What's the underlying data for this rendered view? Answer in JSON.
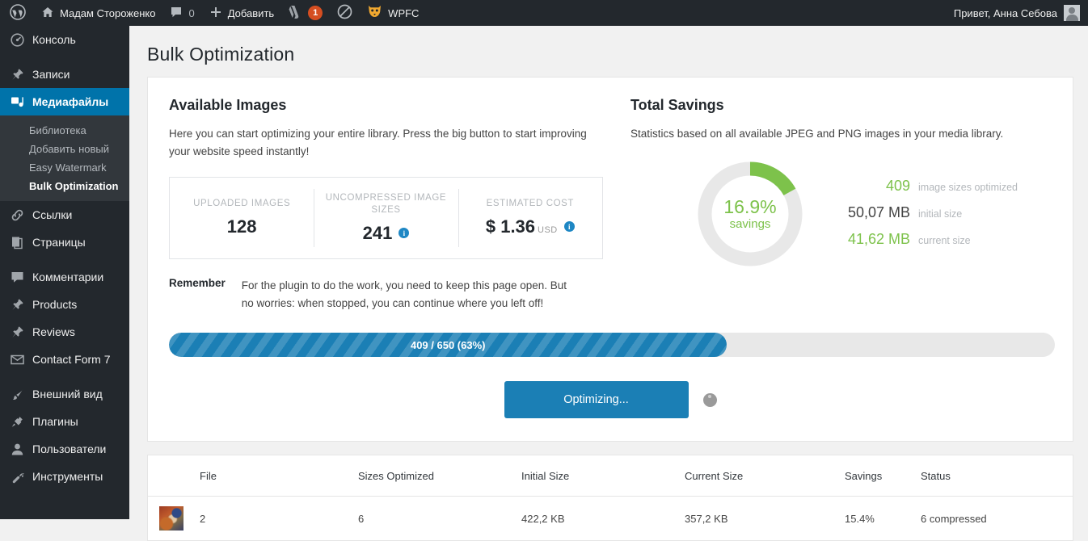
{
  "adminbar": {
    "logo_icon": "wordpress-logo-icon",
    "site_name": "Мадам Стороженко",
    "home_icon": "home-icon",
    "comments_icon": "comment-icon",
    "comments_count": "0",
    "new_icon": "plus-icon",
    "new_label": "Добавить",
    "yoast_icon": "yoast-icon",
    "yoast_badge": "1",
    "block_icon": "no-entry-icon",
    "wpfc_icon": "wpfc-tiger-icon",
    "wpfc_label": "WPFC",
    "greeting": "Привет, Анна Себова",
    "avatar_icon": "avatar"
  },
  "sidebar": {
    "items": [
      {
        "label": "Консоль",
        "icon": "dashboard-icon",
        "current": false
      },
      {
        "label": "Записи",
        "icon": "pin-icon",
        "current": false
      },
      {
        "label": "Медиафайлы",
        "icon": "media-icon",
        "current": true
      },
      {
        "label": "Ссылки",
        "icon": "link-icon",
        "current": false
      },
      {
        "label": "Страницы",
        "icon": "pages-icon",
        "current": false
      },
      {
        "label": "Комментарии",
        "icon": "comment-icon",
        "current": false
      },
      {
        "label": "Products",
        "icon": "pin-icon",
        "current": false
      },
      {
        "label": "Reviews",
        "icon": "pin-icon",
        "current": false
      },
      {
        "label": "Contact Form 7",
        "icon": "envelope-icon",
        "current": false
      },
      {
        "label": "Внешний вид",
        "icon": "brush-icon",
        "current": false
      },
      {
        "label": "Плагины",
        "icon": "plug-icon",
        "current": false
      },
      {
        "label": "Пользователи",
        "icon": "user-icon",
        "current": false
      },
      {
        "label": "Инструменты",
        "icon": "wrench-icon",
        "current": false
      }
    ],
    "submenu": [
      {
        "label": "Библиотека",
        "current": false
      },
      {
        "label": "Добавить новый",
        "current": false
      },
      {
        "label": "Easy Watermark",
        "current": false
      },
      {
        "label": "Bulk Optimization",
        "current": true
      }
    ]
  },
  "page": {
    "title": "Bulk Optimization"
  },
  "available": {
    "heading": "Available Images",
    "description": "Here you can start optimizing your entire library. Press the big button to start improving your website speed instantly!",
    "stats": [
      {
        "label": "UPLOADED IMAGES",
        "value": "128",
        "info": false,
        "unit": ""
      },
      {
        "label": "UNCOMPRESSED IMAGE SIZES",
        "value": "241",
        "info": true,
        "unit": ""
      },
      {
        "label": "ESTIMATED COST",
        "value": "$ 1.36",
        "info": true,
        "unit": "USD"
      }
    ],
    "remember_label": "Remember",
    "remember_text": "For the plugin to do the work, you need to keep this page open. But no worries: when stopped, you can continue where you left off!"
  },
  "savings": {
    "heading": "Total Savings",
    "description": "Statistics based on all available JPEG and PNG images in your media library.",
    "donut_percent": "16.9%",
    "donut_caption": "savings",
    "donut_value": 16.9,
    "accent_green": "#7dc24b",
    "track_gray": "#e8e8e8",
    "rows": [
      {
        "value": "409",
        "caption": "image sizes optimized",
        "style": "green"
      },
      {
        "value": "50,07 MB",
        "caption": "initial size",
        "style": "dark"
      },
      {
        "value": "41,62 MB",
        "caption": "current size",
        "style": "green"
      }
    ]
  },
  "progress": {
    "text": "409 / 650 (63%)",
    "percent": 63,
    "fill_color": "#1b7fb5"
  },
  "action": {
    "button_label": "Optimizing...",
    "spinner_icon": "spinner-icon"
  },
  "table": {
    "columns": [
      "File",
      "Sizes Optimized",
      "Initial Size",
      "Current Size",
      "Savings",
      "Status"
    ],
    "rows": [
      {
        "thumb": "image-thumbnail",
        "file": "2",
        "sizes_optimized": "6",
        "initial_size": "422,2 KB",
        "current_size": "357,2 KB",
        "savings": "15.4%",
        "status": "6 compressed"
      }
    ]
  }
}
